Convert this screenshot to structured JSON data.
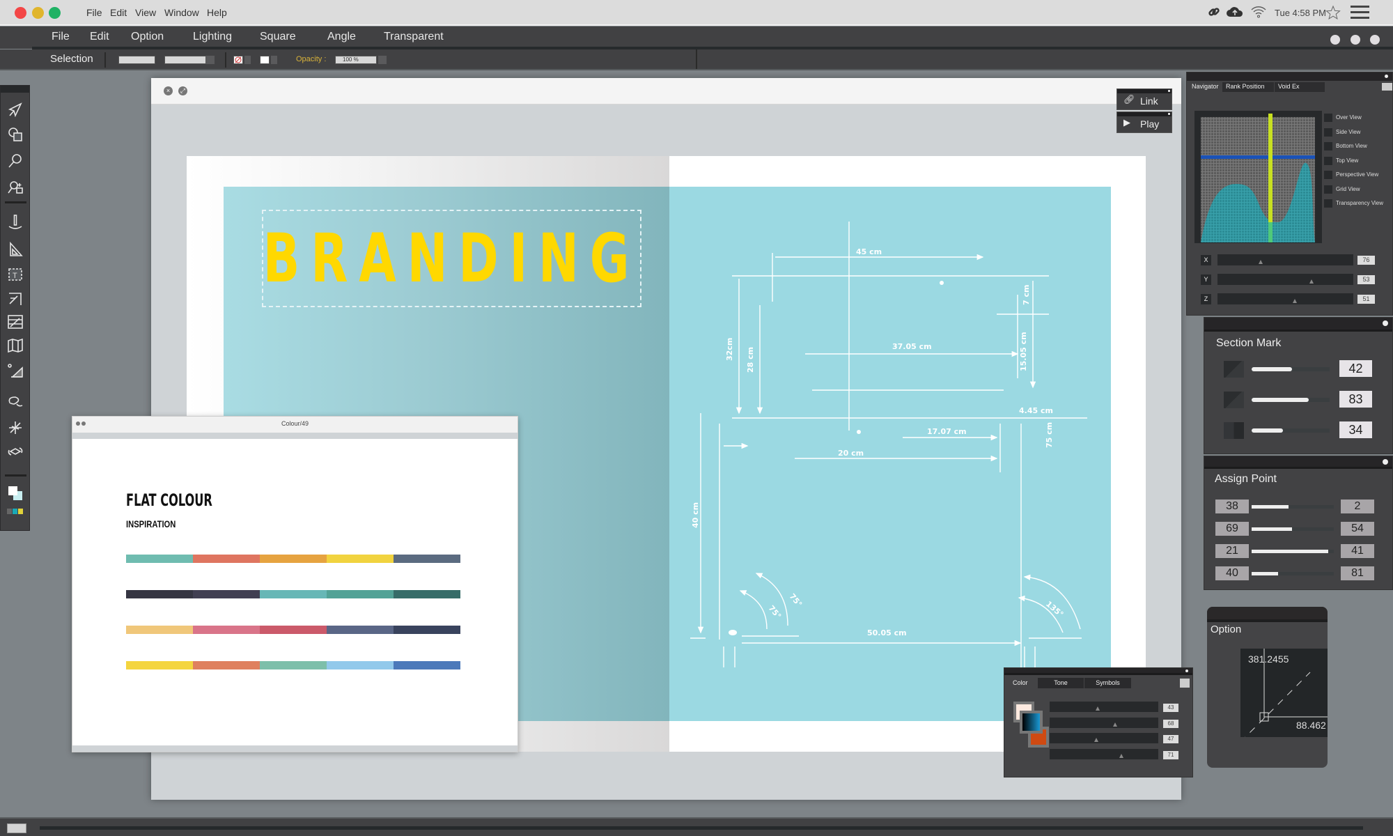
{
  "os_menubar": {
    "menus": [
      "File",
      "Edit",
      "View",
      "Window",
      "Help"
    ],
    "clock": "Tue 4:58 PM",
    "status_icons": [
      "link-icon",
      "cloud-upload-icon",
      "wifi-icon",
      "star-icon",
      "hamburger-menu-icon"
    ]
  },
  "app_menubar": {
    "menus": [
      "File",
      "Edit",
      "Option",
      "Lighting",
      "Square",
      "Angle",
      "Transparent"
    ]
  },
  "options_bar": {
    "tool_label": "Selection",
    "opacity_label": "Opacity :",
    "opacity_value": "100 %"
  },
  "toolbar": {
    "tools": [
      "select-arrow-icon",
      "shape-icon",
      "zoom-icon",
      "zoom-hand-icon",
      "pin-icon",
      "triangle-ruler-icon",
      "text-box-icon",
      "arrow-select-frame-icon",
      "image-transform-icon",
      "map-icon",
      "light-gradient-icon",
      "lasso-icon",
      "star-burst-icon",
      "transform-rotate-icon",
      "foreground-background-color-icon",
      "swatches-icon"
    ]
  },
  "document": {
    "headline": "BRANDING",
    "measurements": {
      "m1": "45 cm",
      "m2": "7 cm",
      "m3": "37.05 cm",
      "m4": "15.05 cm",
      "m5": "32cm",
      "m6": "28 cm",
      "m7": "4.45 cm",
      "m8": "17.07 cm",
      "m9": "20 cm",
      "m10": "75 cm",
      "m11": "40 cm",
      "m12": "50.05 cm",
      "a1": "75°",
      "a2": "75°",
      "a3": "135°"
    }
  },
  "floating_buttons": {
    "link_label": "Link",
    "play_label": "Play"
  },
  "colour_window": {
    "title": "Colour/49",
    "heading": "FLAT COLOUR",
    "subheading": "INSPIRATION",
    "palettes": [
      [
        "#6fbcb0",
        "#df7560",
        "#e6a340",
        "#f1d33f",
        "#5b6b80"
      ],
      [
        "#353542",
        "#413f52",
        "#67b7b6",
        "#52a296",
        "#366c68"
      ],
      [
        "#f0c77a",
        "#d97489",
        "#cb5a6a",
        "#5a6686",
        "#39435d"
      ],
      [
        "#f4d53f",
        "#df805e",
        "#7dbfaa",
        "#92c9eb",
        "#4c79ba"
      ]
    ]
  },
  "navigator_panel": {
    "tabs": [
      "Navigator",
      "Rank Position",
      "Void Ex"
    ],
    "view_options": [
      "Over View",
      "Side View",
      "Bottom View",
      "Top View",
      "Perspective View",
      "Grid View",
      "Transparency View"
    ],
    "axes": [
      {
        "label": "X",
        "value": "76",
        "slider_fraction": 0.32
      },
      {
        "label": "Y",
        "value": "53",
        "slider_fraction": 0.69
      },
      {
        "label": "Z",
        "value": "51",
        "slider_fraction": 0.57
      }
    ]
  },
  "section_mark_panel": {
    "title": "Section Mark",
    "rows": [
      {
        "value": "42",
        "fill_fraction": 0.52
      },
      {
        "value": "83",
        "fill_fraction": 0.73
      },
      {
        "value": "34",
        "fill_fraction": 0.4
      }
    ]
  },
  "assign_point_panel": {
    "title": "Assign Point",
    "rows": [
      {
        "left": "38",
        "right": "2",
        "fill_fraction": 0.45
      },
      {
        "left": "69",
        "right": "54",
        "fill_fraction": 0.49
      },
      {
        "left": "21",
        "right": "41",
        "fill_fraction": 0.93
      },
      {
        "left": "40",
        "right": "81",
        "fill_fraction": 0.32
      }
    ]
  },
  "option_panel": {
    "title": "Option",
    "value_top": "381.2455",
    "value_bottom": "88.462"
  },
  "color_panel": {
    "tabs": [
      "Color",
      "Tone",
      "Symbols"
    ],
    "swatches": {
      "foreground": "#fde9df",
      "middle_gradient": [
        "#000000",
        "#1a98d4"
      ],
      "background": "#cf4a12"
    },
    "sliders": [
      {
        "value": "43",
        "slider_fraction": 0.44
      },
      {
        "value": "68",
        "slider_fraction": 0.6
      },
      {
        "value": "47",
        "slider_fraction": 0.43
      },
      {
        "value": "71",
        "slider_fraction": 0.66
      }
    ]
  },
  "colors": {
    "brand_yellow": "#ffd800",
    "page_blue": "#9bd9e2",
    "panel_dark": "#424244"
  }
}
